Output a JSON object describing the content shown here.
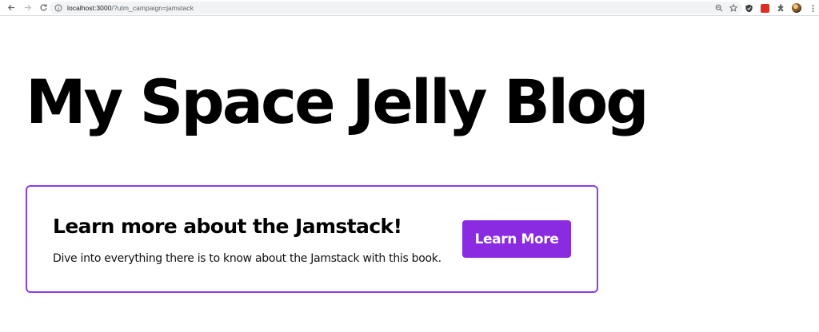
{
  "browser": {
    "url_host": "localhost:3000",
    "url_path": "/?utm_campaign=jamstack",
    "icons": {
      "back": "arrow-left-icon",
      "forward": "arrow-right-icon",
      "reload": "reload-icon",
      "site_info": "info-icon",
      "zoom": "zoom-icon",
      "bookmark": "star-icon",
      "extension_1": "shield-icon",
      "extension_2": "red-extension-icon",
      "extensions_menu": "puzzle-icon",
      "profile": "avatar",
      "menu": "kebab-menu-icon"
    },
    "colors": {
      "omnibox_bg": "#f1f3f4",
      "icon": "#5f6368"
    }
  },
  "page": {
    "title": "My Space Jelly Blog"
  },
  "promo": {
    "heading": "Learn more about the Jamstack!",
    "text": "Dive into everything there is to know about the Jamstack with this book.",
    "button_label": "Learn More",
    "colors": {
      "border": "#8a3ee8",
      "button_bg": "#8a2be2",
      "button_text": "#ffffff"
    }
  }
}
